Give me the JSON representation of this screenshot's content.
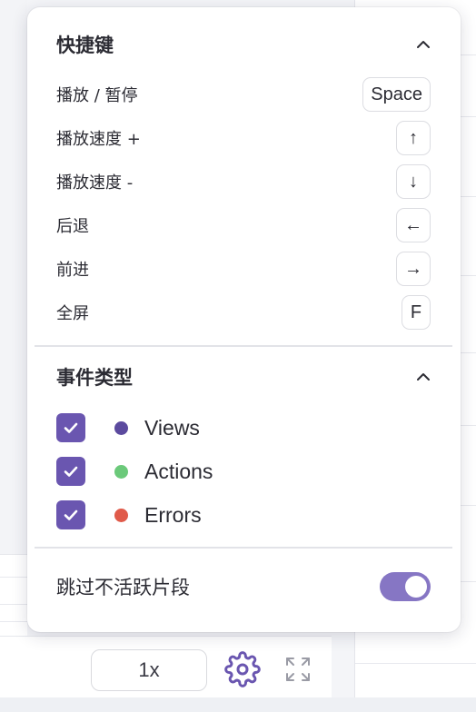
{
  "shortcuts": {
    "title": "快捷键",
    "items": [
      {
        "label": "播放 / 暂停",
        "key": "Space"
      },
      {
        "label": "播放速度 +",
        "key": "↑"
      },
      {
        "label": "播放速度 -",
        "key": "↓"
      },
      {
        "label": "后退",
        "key": "←"
      },
      {
        "label": "前进",
        "key": "→"
      },
      {
        "label": "全屏",
        "key": "F"
      }
    ]
  },
  "event_types": {
    "title": "事件类型",
    "items": [
      {
        "label": "Views",
        "checked": true,
        "color": "#5b4a9e"
      },
      {
        "label": "Actions",
        "checked": true,
        "color": "#6bc97a"
      },
      {
        "label": "Errors",
        "checked": true,
        "color": "#e05a4a"
      }
    ]
  },
  "skip_inactive": {
    "label": "跳过不活跃片段",
    "enabled": true
  },
  "controls": {
    "speed": "1x",
    "settings_icon": "gear-icon",
    "fullscreen_icon": "expand-icon"
  },
  "colors": {
    "accent": "#6a56b0",
    "toggle_on": "#8676c4"
  }
}
